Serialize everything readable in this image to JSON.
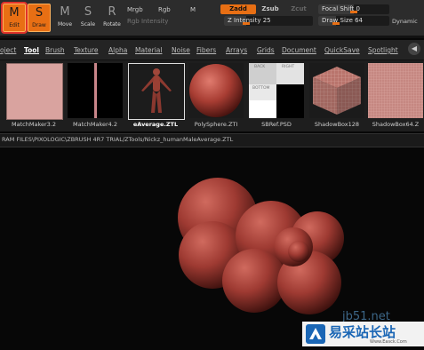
{
  "toolbar": {
    "buttons": [
      {
        "label": "Edit",
        "icon": "edit-icon"
      },
      {
        "label": "Draw",
        "icon": "draw-icon"
      },
      {
        "label": "Move",
        "icon": "move-icon"
      },
      {
        "label": "Scale",
        "icon": "scale-icon"
      },
      {
        "label": "Rotate",
        "icon": "rotate-icon"
      }
    ],
    "button_glyphs": {
      "edit": "M",
      "draw": "S",
      "move": "M",
      "scale": "S",
      "rotate": "R"
    },
    "mrgb": "Mrgb",
    "rgb": "Rgb",
    "m": "M",
    "rgb_intensity": "Rgb Intensity",
    "zadd": "Zadd",
    "zsub": "Zsub",
    "zcut": "Zcut",
    "z_intensity": "Z Intensity 25",
    "z_intensity_value": 25,
    "focal_shift": "Focal Shift 0",
    "focal_shift_value": 0,
    "draw_size": "Draw Size 64",
    "draw_size_value": 64,
    "dynamic": "Dynamic"
  },
  "menubar": {
    "items": [
      "oject",
      "Tool",
      "Brush",
      "Texture",
      "Alpha",
      "Material",
      "Noise",
      "Fibers",
      "Arrays",
      "Grids",
      "Document",
      "QuickSave",
      "Spotlight"
    ],
    "active": "Tool"
  },
  "tools": [
    {
      "label": "MatchMaker3.2"
    },
    {
      "label": "MatchMaker4.2"
    },
    {
      "label": "eAverage.ZTL"
    },
    {
      "label": "PolySphere.ZTI"
    },
    {
      "label": "SBRef.PSD"
    },
    {
      "label": "ShadowBox128"
    },
    {
      "label": "ShadowBox64.Z"
    }
  ],
  "sbref_cells": [
    "BACK",
    "RIGHT",
    "BOTTOM"
  ],
  "path": "RAM FILES\\PIXOLOGIC\\ZBRUSH 4R7 TRIAL/ZTools/Nickz_humanMaleAverage.ZTL",
  "watermark": {
    "main": "易采站长站",
    "url": "jb51.net",
    "small": "Www.Easck.Com"
  },
  "colors": {
    "accent": "#e86f14",
    "clay": "#a33b35"
  }
}
